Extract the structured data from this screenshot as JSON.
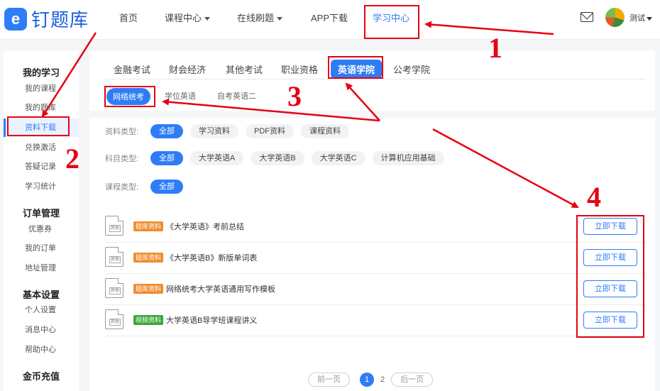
{
  "brand": {
    "logo_glyph": "e",
    "name": "钉题库",
    "color": "#2f7df6"
  },
  "topnav": {
    "items": [
      {
        "label": "首页",
        "has_caret": false
      },
      {
        "label": "课程中心",
        "has_caret": true
      },
      {
        "label": "在线刷题",
        "has_caret": true
      },
      {
        "label": "APP下载",
        "has_caret": false
      },
      {
        "label": "学习中心",
        "has_caret": false,
        "active": true
      }
    ],
    "mail_icon": "mail-icon",
    "user_name": "测试"
  },
  "sidebar": {
    "groups": [
      {
        "title": "我的学习",
        "items": [
          "我的课程",
          "我的题库",
          "资料下载",
          "兑换激活",
          "答疑记录",
          "学习统计"
        ]
      },
      {
        "title": "订单管理",
        "items": [
          "优惠券",
          "我的订单",
          "地址管理"
        ]
      },
      {
        "title": "基本设置",
        "items": [
          "个人设置",
          "消息中心",
          "帮助中心"
        ]
      },
      {
        "title": "金币充值",
        "items": []
      }
    ],
    "active_item": "资料下载"
  },
  "category_tabs": [
    "金融考试",
    "财会经济",
    "其他考试",
    "职业资格",
    "英语学院",
    "公考学院"
  ],
  "active_category": "英语学院",
  "sub_tabs": [
    "网络统考",
    "学位英语",
    "自考英语二"
  ],
  "active_sub_tab": "网络统考",
  "filters": [
    {
      "label": "资料类型:",
      "options": [
        "全部",
        "学习资料",
        "PDF资料",
        "课程资料"
      ],
      "selected": "全部"
    },
    {
      "label": "科目类型:",
      "options": [
        "全部",
        "大学英语A",
        "大学英语B",
        "大学英语C",
        "计算机应用基础"
      ],
      "selected": "全部"
    },
    {
      "label": "课程类型:",
      "options": [
        "全部"
      ],
      "selected": "全部"
    }
  ],
  "files": [
    {
      "icon_text": "其他",
      "tag": "题库资料",
      "tag_color": "#f08c2e",
      "title": "《大学英语》考前总结",
      "button": "立即下载"
    },
    {
      "icon_text": "其他",
      "tag": "题库资料",
      "tag_color": "#f08c2e",
      "title": "《大学英语B》新版单词表",
      "button": "立即下载"
    },
    {
      "icon_text": "其他",
      "tag": "题库资料",
      "tag_color": "#f08c2e",
      "title": "网络统考大学英语通用写作模板",
      "button": "立即下载"
    },
    {
      "icon_text": "其他",
      "tag": "视频资料",
      "tag_color": "#3aa83a",
      "title": "大学英语B导学班课程讲义",
      "button": "立即下载"
    }
  ],
  "pagination": {
    "prev": "前一页",
    "pages": [
      "1",
      "2"
    ],
    "current": "1",
    "next": "后一页"
  },
  "annotations": {
    "numbers": [
      "1",
      "2",
      "3",
      "4"
    ],
    "color": "#e60012"
  }
}
